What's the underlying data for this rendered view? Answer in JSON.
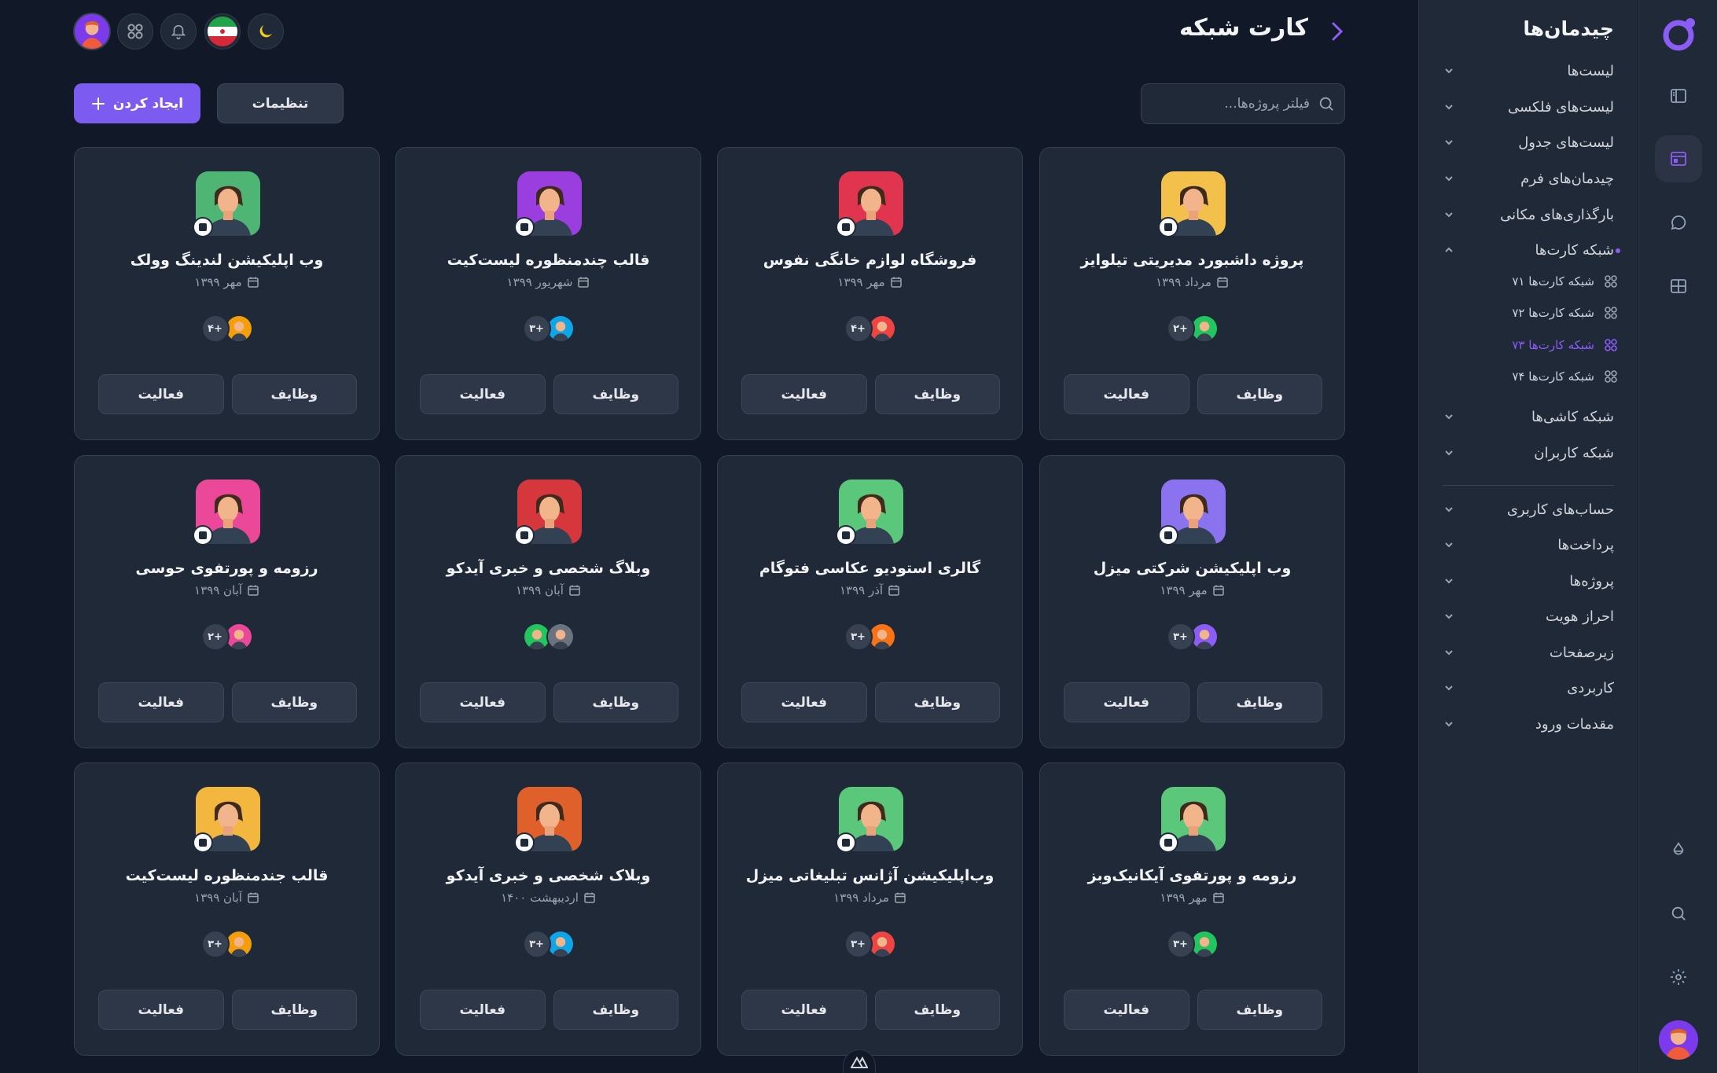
{
  "sidebar": {
    "title": "چیدمان‌ها",
    "items": [
      {
        "label": "لیست‌ها"
      },
      {
        "label": "لیست‌های فلکسی"
      },
      {
        "label": "لیست‌های جدول"
      },
      {
        "label": "چیدمان‌های فرم"
      },
      {
        "label": "بارگذاری‌های مکانی"
      },
      {
        "label": "شبکه کارت‌ها"
      },
      {
        "label": "شبکه کاشی‌ها"
      },
      {
        "label": "شبکه کاربران"
      },
      {
        "label": "حساب‌های کاربری"
      },
      {
        "label": "پرداخت‌ها"
      },
      {
        "label": "پروژه‌ها"
      },
      {
        "label": "احراز هویت"
      },
      {
        "label": "زیرصفحات"
      },
      {
        "label": "کاربردی"
      },
      {
        "label": "مقدمات ورود"
      }
    ],
    "subitems": [
      {
        "label": "شبکه کارت‌ها ۷۱"
      },
      {
        "label": "شبکه کارت‌ها ۷۲"
      },
      {
        "label": "شبکه کارت‌ها ۷۳"
      },
      {
        "label": "شبکه کارت‌ها ۷۴"
      }
    ]
  },
  "header": {
    "title": "کارت شبکه"
  },
  "toolbar": {
    "search_placeholder": "فیلتر پروژه‌ها...",
    "settings_label": "تنظیمات",
    "create_label": "ایجاد کردن"
  },
  "card_buttons": {
    "tasks": "وظایف",
    "activity": "فعالیت"
  },
  "cards": [
    {
      "title": "پروژه داشبورد مدیریتی تیلوایز",
      "date": "مرداد ۱۳۹۹",
      "count": "۲+",
      "bg": "#f3c14b"
    },
    {
      "title": "فروشگاه لوازم خانگی نفوس",
      "date": "مهر ۱۳۹۹",
      "count": "۴+",
      "bg": "#e0344f"
    },
    {
      "title": "قالب چندمنظوره لیست‌کیت",
      "date": "شهریور ۱۳۹۹",
      "count": "۳+",
      "bg": "#9a3ee0"
    },
    {
      "title": "وب اپلیکیشن لندینگ وولک",
      "date": "مهر ۱۳۹۹",
      "count": "۴+",
      "bg": "#4fb575"
    },
    {
      "title": "وب اپلیکیشن شرکتی میزل",
      "date": "مهر ۱۳۹۹",
      "count": "۳+",
      "bg": "#8b73f0"
    },
    {
      "title": "گالری استودیو عکاسی فتوگام",
      "date": "آذر ۱۳۹۹",
      "count": "۳+",
      "bg": "#5ac77a"
    },
    {
      "title": "وبلاگ شخصی و خبری آیدکو",
      "date": "آبان ۱۳۹۹",
      "count": "",
      "bg": "#d6373d"
    },
    {
      "title": "رزومه و پورتفوی حوسی",
      "date": "آبان ۱۳۹۹",
      "count": "۲+",
      "bg": "#ec4899"
    },
    {
      "title": "رزومه و پورتفوی آیکانیک‌وبز",
      "date": "مهر ۱۳۹۹",
      "count": "۳+",
      "bg": "#5ac77a"
    },
    {
      "title": "وب‌اپلیکیشن آژانس تبلیغاتی میزل",
      "date": "مرداد ۱۳۹۹",
      "count": "۳+",
      "bg": "#5ac77a"
    },
    {
      "title": "وبلاک شخصی و خبری آیدکو",
      "date": "اردیبهشت ۱۴۰۰",
      "count": "۳+",
      "bg": "#e0602c"
    },
    {
      "title": "قالب جندمنظوره لیست‌کیت",
      "date": "آبان ۱۳۹۹",
      "count": "۳+",
      "bg": "#f3b63f"
    }
  ],
  "colors": {
    "accent": "#8b5cf6",
    "primary_button": "#7c5cf0",
    "background": "#111827",
    "surface": "#1f2937"
  },
  "icons": {
    "header": [
      "moon-icon",
      "iran-flag-icon",
      "bell-icon",
      "grid-icon"
    ],
    "rail": [
      "sidebar-icon",
      "layout-icon",
      "chat-icon",
      "table-icon",
      "theme-drop-icon",
      "search-icon",
      "gear-icon"
    ]
  }
}
